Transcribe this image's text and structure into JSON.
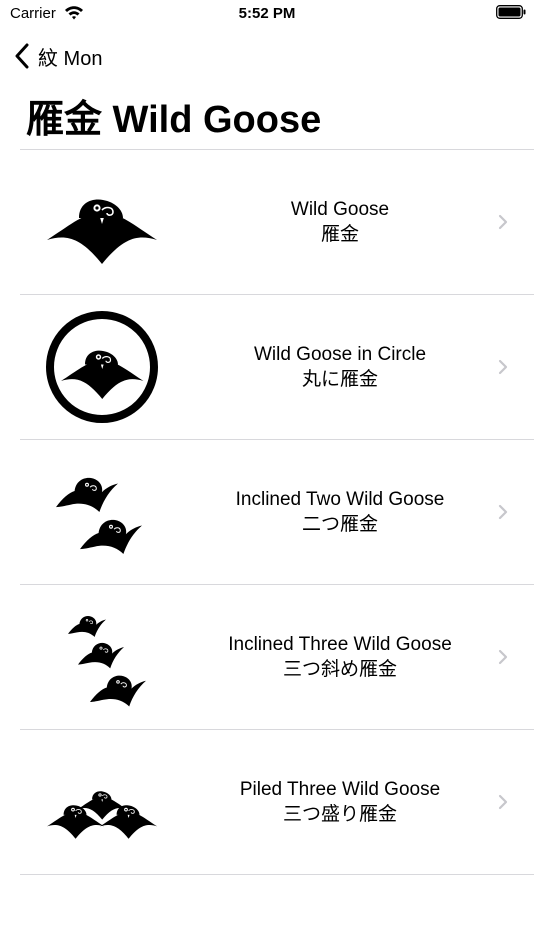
{
  "status_bar": {
    "carrier": "Carrier",
    "time": "5:52 PM"
  },
  "nav": {
    "back_label": "紋 Mon"
  },
  "page": {
    "title": "雁金 Wild Goose"
  },
  "rows": [
    {
      "title_en": "Wild Goose",
      "title_ja": "雁金",
      "crest": "wild-goose-crest-icon"
    },
    {
      "title_en": "Wild Goose in Circle",
      "title_ja": "丸に雁金",
      "crest": "wild-goose-in-circle-crest-icon"
    },
    {
      "title_en": "Inclined Two Wild Goose",
      "title_ja": "二つ雁金",
      "crest": "inclined-two-wild-goose-crest-icon"
    },
    {
      "title_en": "Inclined Three Wild Goose",
      "title_ja": "三つ斜め雁金",
      "crest": "inclined-three-wild-goose-crest-icon"
    },
    {
      "title_en": "Piled Three Wild Goose",
      "title_ja": "三つ盛り雁金",
      "crest": "piled-three-wild-goose-crest-icon"
    }
  ],
  "colors": {
    "background": "#ffffff",
    "separator": "#d8d8dc",
    "chevron": "#c7c7cc",
    "crest": "#000000"
  }
}
